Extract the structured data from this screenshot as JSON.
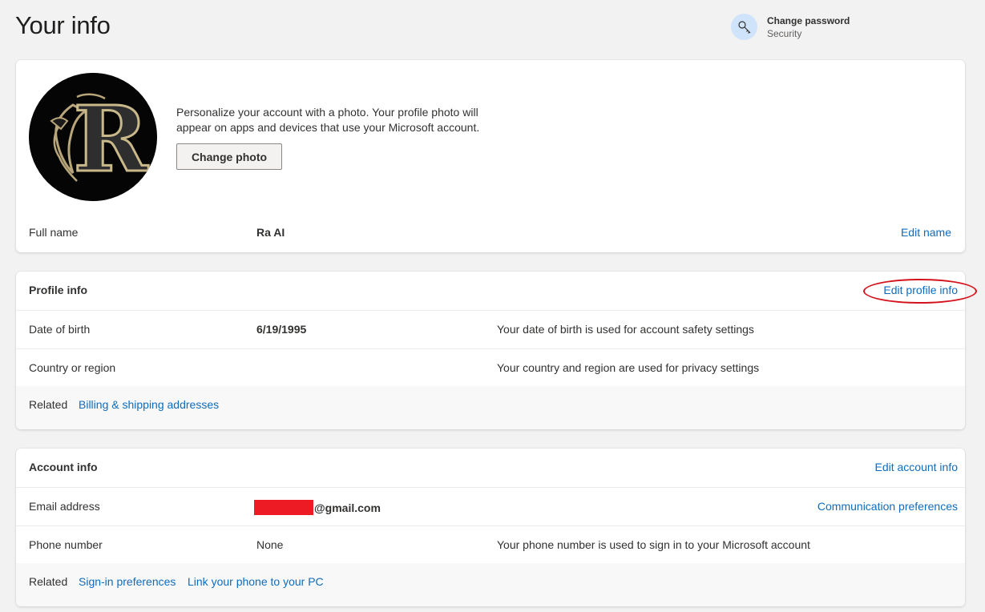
{
  "header": {
    "title": "Your info",
    "change_password": {
      "title": "Change password",
      "subtitle": "Security",
      "icon": "key-icon"
    }
  },
  "photo_card": {
    "description": "Personalize your account with a photo. Your profile photo will appear on apps and devices that use your Microsoft account.",
    "change_photo_label": "Change photo",
    "avatar_letter": "R",
    "full_name_label": "Full name",
    "full_name_value": "Ra AI",
    "edit_name_label": "Edit name"
  },
  "profile_info": {
    "heading": "Profile info",
    "edit_label": "Edit profile info",
    "rows": [
      {
        "label": "Date of birth",
        "value": "6/19/1995",
        "desc": "Your date of birth is used for account safety settings"
      },
      {
        "label": "Country or region",
        "value": "",
        "desc": "Your country and region are used for privacy settings"
      }
    ],
    "related_label": "Related",
    "related_links": [
      "Billing & shipping addresses"
    ]
  },
  "account_info": {
    "heading": "Account info",
    "edit_label": "Edit account info",
    "email_label": "Email address",
    "email_suffix": "@gmail.com",
    "email_link": "Communication preferences",
    "phone_label": "Phone number",
    "phone_value": "None",
    "phone_desc": "Your phone number is used to sign in to your Microsoft account",
    "related_label": "Related",
    "related_links": [
      "Sign-in preferences",
      "Link your phone to your PC"
    ]
  },
  "colors": {
    "link": "#0f6cbd",
    "annotation": "#d4141c",
    "redaction": "#ed1c24",
    "background": "#f2f2f2"
  }
}
